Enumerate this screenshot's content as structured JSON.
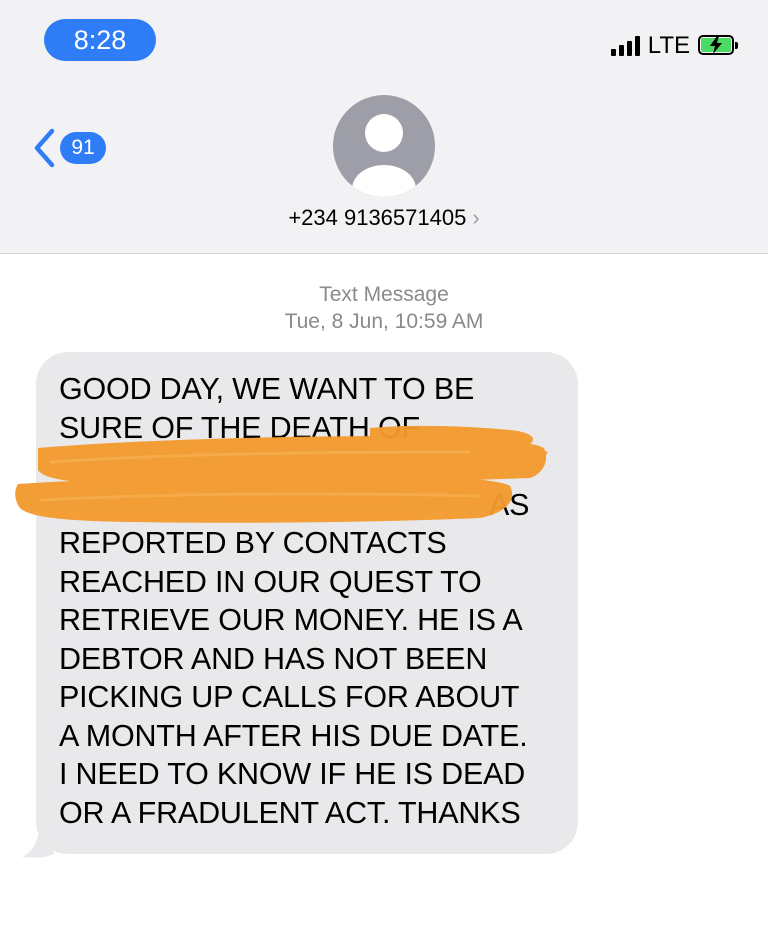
{
  "status_bar": {
    "time": "8:28",
    "network": "LTE",
    "icons": [
      "signal-icon",
      "battery-charging-icon"
    ],
    "colors": {
      "time_pill": "#2f7df6",
      "battery_fill": "#4cd964"
    }
  },
  "nav": {
    "back_icon": "chevron-left-icon",
    "unread_badge": "91"
  },
  "contact": {
    "avatar_icon": "person-placeholder-icon",
    "phone": "+234 9136571405",
    "chevron": "›"
  },
  "thread": {
    "service_label": "Text Message",
    "timestamp": "Tue, 8 Jun, 10:59 AM"
  },
  "message": {
    "lines": [
      "GOOD DAY, WE WANT TO BE",
      "SURE OF THE DEATH OF",
      "",
      "AS",
      "REPORTED BY CONTACTS",
      "REACHED IN OUR QUEST TO",
      "RETRIEVE OUR MONEY. HE IS A",
      "DEBTOR AND HAS NOT BEEN",
      "PICKING UP CALLS FOR ABOUT",
      "A MONTH AFTER HIS DUE DATE.",
      "I NEED TO KNOW IF HE IS DEAD",
      "OR A FRADULENT ACT. THANKS"
    ],
    "redaction_color": "#f39a2e",
    "bubble_color": "#e9e9eb"
  }
}
